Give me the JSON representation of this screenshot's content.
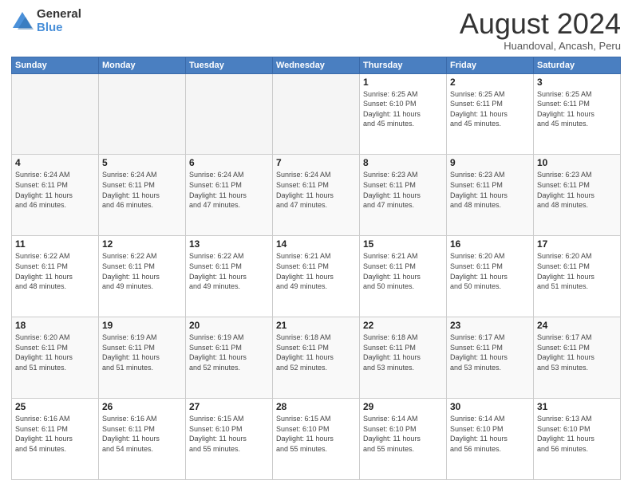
{
  "header": {
    "logo_line1": "General",
    "logo_line2": "Blue",
    "month": "August 2024",
    "location": "Huandoval, Ancash, Peru"
  },
  "weekdays": [
    "Sunday",
    "Monday",
    "Tuesday",
    "Wednesday",
    "Thursday",
    "Friday",
    "Saturday"
  ],
  "weeks": [
    [
      {
        "day": "",
        "info": ""
      },
      {
        "day": "",
        "info": ""
      },
      {
        "day": "",
        "info": ""
      },
      {
        "day": "",
        "info": ""
      },
      {
        "day": "1",
        "info": "Sunrise: 6:25 AM\nSunset: 6:10 PM\nDaylight: 11 hours\nand 45 minutes."
      },
      {
        "day": "2",
        "info": "Sunrise: 6:25 AM\nSunset: 6:11 PM\nDaylight: 11 hours\nand 45 minutes."
      },
      {
        "day": "3",
        "info": "Sunrise: 6:25 AM\nSunset: 6:11 PM\nDaylight: 11 hours\nand 45 minutes."
      }
    ],
    [
      {
        "day": "4",
        "info": "Sunrise: 6:24 AM\nSunset: 6:11 PM\nDaylight: 11 hours\nand 46 minutes."
      },
      {
        "day": "5",
        "info": "Sunrise: 6:24 AM\nSunset: 6:11 PM\nDaylight: 11 hours\nand 46 minutes."
      },
      {
        "day": "6",
        "info": "Sunrise: 6:24 AM\nSunset: 6:11 PM\nDaylight: 11 hours\nand 47 minutes."
      },
      {
        "day": "7",
        "info": "Sunrise: 6:24 AM\nSunset: 6:11 PM\nDaylight: 11 hours\nand 47 minutes."
      },
      {
        "day": "8",
        "info": "Sunrise: 6:23 AM\nSunset: 6:11 PM\nDaylight: 11 hours\nand 47 minutes."
      },
      {
        "day": "9",
        "info": "Sunrise: 6:23 AM\nSunset: 6:11 PM\nDaylight: 11 hours\nand 48 minutes."
      },
      {
        "day": "10",
        "info": "Sunrise: 6:23 AM\nSunset: 6:11 PM\nDaylight: 11 hours\nand 48 minutes."
      }
    ],
    [
      {
        "day": "11",
        "info": "Sunrise: 6:22 AM\nSunset: 6:11 PM\nDaylight: 11 hours\nand 48 minutes."
      },
      {
        "day": "12",
        "info": "Sunrise: 6:22 AM\nSunset: 6:11 PM\nDaylight: 11 hours\nand 49 minutes."
      },
      {
        "day": "13",
        "info": "Sunrise: 6:22 AM\nSunset: 6:11 PM\nDaylight: 11 hours\nand 49 minutes."
      },
      {
        "day": "14",
        "info": "Sunrise: 6:21 AM\nSunset: 6:11 PM\nDaylight: 11 hours\nand 49 minutes."
      },
      {
        "day": "15",
        "info": "Sunrise: 6:21 AM\nSunset: 6:11 PM\nDaylight: 11 hours\nand 50 minutes."
      },
      {
        "day": "16",
        "info": "Sunrise: 6:20 AM\nSunset: 6:11 PM\nDaylight: 11 hours\nand 50 minutes."
      },
      {
        "day": "17",
        "info": "Sunrise: 6:20 AM\nSunset: 6:11 PM\nDaylight: 11 hours\nand 51 minutes."
      }
    ],
    [
      {
        "day": "18",
        "info": "Sunrise: 6:20 AM\nSunset: 6:11 PM\nDaylight: 11 hours\nand 51 minutes."
      },
      {
        "day": "19",
        "info": "Sunrise: 6:19 AM\nSunset: 6:11 PM\nDaylight: 11 hours\nand 51 minutes."
      },
      {
        "day": "20",
        "info": "Sunrise: 6:19 AM\nSunset: 6:11 PM\nDaylight: 11 hours\nand 52 minutes."
      },
      {
        "day": "21",
        "info": "Sunrise: 6:18 AM\nSunset: 6:11 PM\nDaylight: 11 hours\nand 52 minutes."
      },
      {
        "day": "22",
        "info": "Sunrise: 6:18 AM\nSunset: 6:11 PM\nDaylight: 11 hours\nand 53 minutes."
      },
      {
        "day": "23",
        "info": "Sunrise: 6:17 AM\nSunset: 6:11 PM\nDaylight: 11 hours\nand 53 minutes."
      },
      {
        "day": "24",
        "info": "Sunrise: 6:17 AM\nSunset: 6:11 PM\nDaylight: 11 hours\nand 53 minutes."
      }
    ],
    [
      {
        "day": "25",
        "info": "Sunrise: 6:16 AM\nSunset: 6:11 PM\nDaylight: 11 hours\nand 54 minutes."
      },
      {
        "day": "26",
        "info": "Sunrise: 6:16 AM\nSunset: 6:11 PM\nDaylight: 11 hours\nand 54 minutes."
      },
      {
        "day": "27",
        "info": "Sunrise: 6:15 AM\nSunset: 6:10 PM\nDaylight: 11 hours\nand 55 minutes."
      },
      {
        "day": "28",
        "info": "Sunrise: 6:15 AM\nSunset: 6:10 PM\nDaylight: 11 hours\nand 55 minutes."
      },
      {
        "day": "29",
        "info": "Sunrise: 6:14 AM\nSunset: 6:10 PM\nDaylight: 11 hours\nand 55 minutes."
      },
      {
        "day": "30",
        "info": "Sunrise: 6:14 AM\nSunset: 6:10 PM\nDaylight: 11 hours\nand 56 minutes."
      },
      {
        "day": "31",
        "info": "Sunrise: 6:13 AM\nSunset: 6:10 PM\nDaylight: 11 hours\nand 56 minutes."
      }
    ]
  ]
}
